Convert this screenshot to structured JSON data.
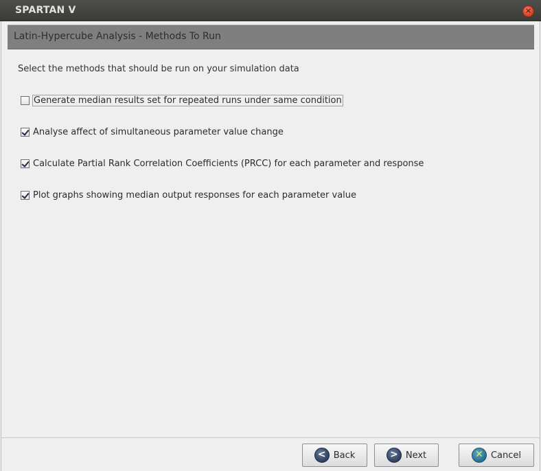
{
  "window": {
    "title": "SPARTAN V",
    "close_glyph": "×"
  },
  "header": {
    "title": "Latin-Hypercube Analysis - Methods To Run"
  },
  "instruction": "Select the methods that should be run on your simulation data",
  "options": [
    {
      "label": "Generate median results set for repeated runs under same condition",
      "checked": false
    },
    {
      "label": "Analyse affect of simultaneous parameter value change",
      "checked": true
    },
    {
      "label": "Calculate Partial Rank Correlation Coefficients (PRCC) for each parameter and response",
      "checked": true
    },
    {
      "label": "Plot graphs showing median output responses for each parameter value",
      "checked": true
    }
  ],
  "buttons": {
    "back": {
      "label": "Back",
      "icon": "left-arrow-icon",
      "glyph": "<"
    },
    "next": {
      "label": "Next",
      "icon": "right-arrow-icon",
      "glyph": ">"
    },
    "cancel": {
      "label": "Cancel",
      "icon": "cancel-x-icon",
      "glyph": "✕"
    }
  }
}
